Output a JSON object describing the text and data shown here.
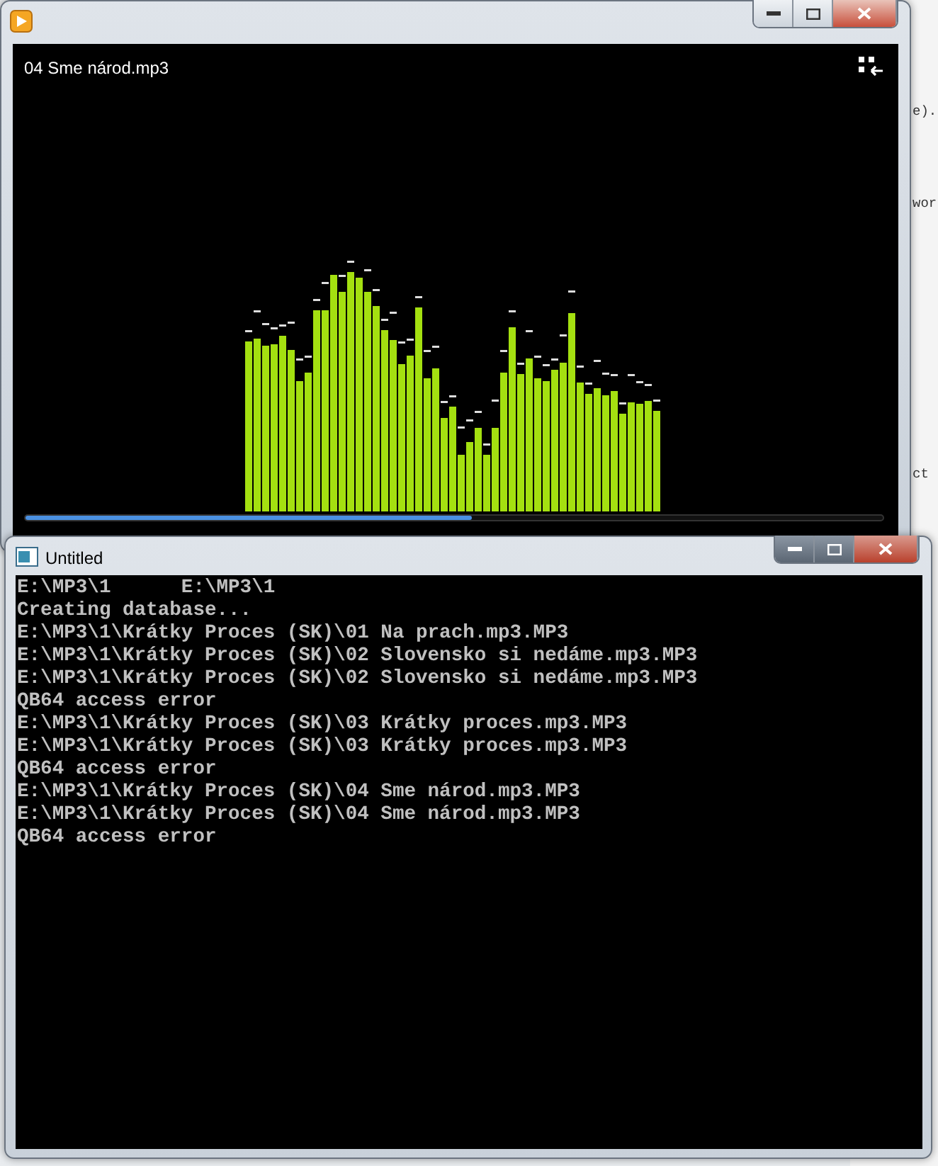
{
  "background_window": {
    "fragments": [
      "e).",
      "wor",
      "ct"
    ]
  },
  "player_window": {
    "title": "04 Sme národ.mp3",
    "seek": {
      "level": 0.52
    }
  },
  "console_window": {
    "title": "Untitled",
    "lines": [
      "E:\\MP3\\1      E:\\MP3\\1",
      "Creating database...",
      "E:\\MP3\\1\\Krátky Proces (SK)\\01 Na prach.mp3.MP3",
      "E:\\MP3\\1\\Krátky Proces (SK)\\02 Slovensko si nedáme.mp3.MP3",
      "E:\\MP3\\1\\Krátky Proces (SK)\\02 Slovensko si nedáme.mp3.MP3",
      "QB64 access error",
      "E:\\MP3\\1\\Krátky Proces (SK)\\03 Krátky proces.mp3.MP3",
      "E:\\MP3\\1\\Krátky Proces (SK)\\03 Krátky proces.mp3.MP3",
      "QB64 access error",
      "E:\\MP3\\1\\Krátky Proces (SK)\\04 Sme národ.mp3.MP3",
      "E:\\MP3\\1\\Krátky Proces (SK)\\04 Sme národ.mp3.MP3",
      "QB64 access error"
    ]
  }
}
